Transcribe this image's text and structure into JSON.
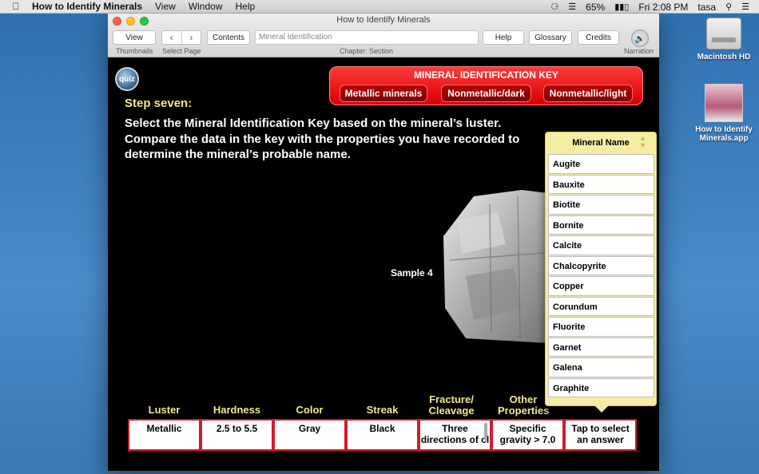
{
  "menubar": {
    "app_name": "How to Identify Minerals",
    "menus": [
      "View",
      "Window",
      "Help"
    ],
    "battery": "65%",
    "clock": "Fri 2:08 PM",
    "user": "tasa"
  },
  "desktop": {
    "icons": [
      {
        "label": "Macintosh HD"
      },
      {
        "label": "How to Identify Minerals.app"
      }
    ]
  },
  "window": {
    "title": "How to Identify Minerals",
    "toolbar": {
      "view_label": "View",
      "thumbnails_caption": "Thumbnails",
      "select_page_caption": "Select Page",
      "contents_label": "Contents",
      "search_text": "Mineral Identification",
      "chapter_caption": "Chapter: Section",
      "help_label": "Help",
      "glossary_label": "Glossary",
      "credits_label": "Credits",
      "narration_caption": "Narration"
    }
  },
  "page": {
    "quiz_label": "quiz",
    "key": {
      "title": "MINERAL IDENTIFICATION KEY",
      "buttons": [
        "Metallic minerals",
        "Nonmetallic/dark",
        "Nonmetallic/light"
      ]
    },
    "step_title": "Step seven:",
    "instructions": "Select the Mineral Identification Key based on the mineral’s luster. Compare the data in the key with the properties you have recorded to determine the mineral’s probable name.",
    "sample_label": "Sample 4",
    "table": {
      "headers": [
        "Luster",
        "Hardness",
        "Color",
        "Streak",
        "Fracture/ Cleavage",
        "Other Properties",
        ""
      ],
      "values": [
        "Metallic",
        "2.5 to 5.5",
        "Gray",
        "Black",
        "Three directions of cl",
        "Specific gravity > 7.0",
        "Tap to select an answer"
      ]
    },
    "dropdown": {
      "header": "Mineral Name",
      "items": [
        "Augite",
        "Bauxite",
        "Biotite",
        "Bornite",
        "Calcite",
        "Chalcopyrite",
        "Copper",
        "Corundum",
        "Fluorite",
        "Garnet",
        "Galena",
        "Graphite"
      ]
    }
  }
}
